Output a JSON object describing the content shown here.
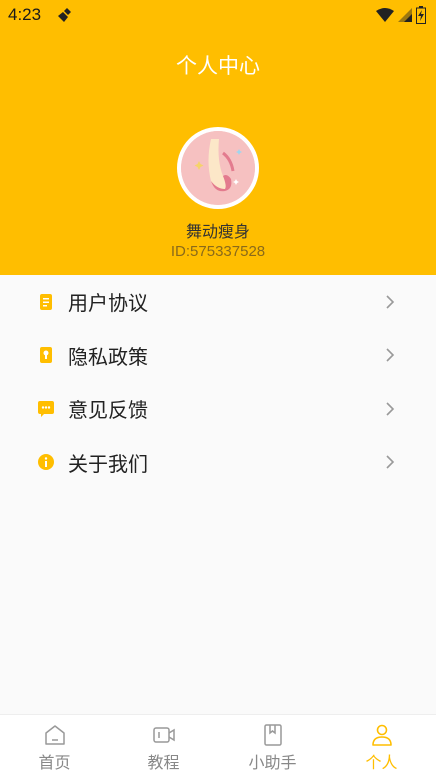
{
  "status": {
    "time": "4:23"
  },
  "header": {
    "title": "个人中心",
    "username": "舞动瘦身",
    "user_id": "ID:575337528"
  },
  "menu": [
    {
      "label": "用户协议",
      "icon": "document-icon"
    },
    {
      "label": "隐私政策",
      "icon": "lock-icon"
    },
    {
      "label": "意见反馈",
      "icon": "message-icon"
    },
    {
      "label": "关于我们",
      "icon": "info-icon"
    }
  ],
  "tabs": [
    {
      "label": "首页",
      "icon": "home-icon",
      "active": false
    },
    {
      "label": "教程",
      "icon": "video-icon",
      "active": false
    },
    {
      "label": "小助手",
      "icon": "book-icon",
      "active": false
    },
    {
      "label": "个人",
      "icon": "person-icon",
      "active": true
    }
  ],
  "colors": {
    "accent": "#FFBE00",
    "icon": "#FFBE00"
  }
}
